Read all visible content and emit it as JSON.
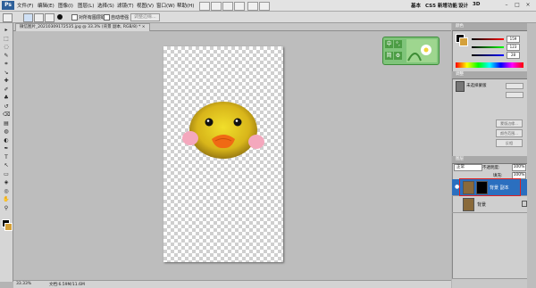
{
  "app": {
    "logo": "Ps"
  },
  "menu": [
    "文件(F)",
    "编辑(E)",
    "图像(I)",
    "图层(L)",
    "选择(S)",
    "滤镜(T)",
    "视图(V)",
    "窗口(W)",
    "帮助(H)"
  ],
  "workspace": {
    "basic": "基本",
    "cs5": "CS5 新增功能",
    "design": "设计",
    "threed": "3D"
  },
  "window_controls": [
    "–",
    "□",
    "×"
  ],
  "options": {
    "sample_all": "对所有图层取样",
    "auto_enhance": "自动增强",
    "refine_edge": "调整边缘..."
  },
  "doc_tab": {
    "title": "微信图片_20210309172535.jpg @ 33.3% (背景 副本, RGB/8) * ×"
  },
  "status": {
    "zoom": "33.33%",
    "doc": "文档:6.59M/11.6M"
  },
  "ime": {
    "zh": "中",
    "dot": "°,",
    "col": "简",
    "gear": "⚙"
  },
  "colors": {
    "fg": "#000000",
    "bg": "#d4a03a",
    "selected_layer": "#2b6fbf",
    "highlight_border": "#e02020"
  },
  "color_panel": {
    "values": [
      "159",
      "123",
      "28"
    ]
  },
  "adjust_panel": {
    "title": "调整",
    "item": "未选择蒙版"
  },
  "mask_panel": {
    "buttons": [
      "蒙版边缘...",
      "颜色范围...",
      "反相"
    ]
  },
  "layers_panel": {
    "blend": "正常",
    "opacity_label": "不透明度:",
    "opacity": "100%",
    "fill_label": "填充:",
    "fill": "100%",
    "layers": [
      {
        "name": "背景 副本",
        "selected": true
      },
      {
        "name": "背景",
        "selected": false
      }
    ]
  },
  "tool_icons": [
    "move-icon",
    "marquee-icon",
    "lasso-icon",
    "quick-select-icon",
    "crop-icon",
    "eyedropper-icon",
    "healing-icon",
    "brush-icon",
    "stamp-icon",
    "history-brush-icon",
    "eraser-icon",
    "gradient-icon",
    "blur-icon",
    "dodge-icon",
    "pen-icon",
    "type-icon",
    "path-select-icon",
    "shape-icon",
    "3d-rotate-icon",
    "3d-orbit-icon",
    "hand-icon",
    "zoom-icon"
  ]
}
